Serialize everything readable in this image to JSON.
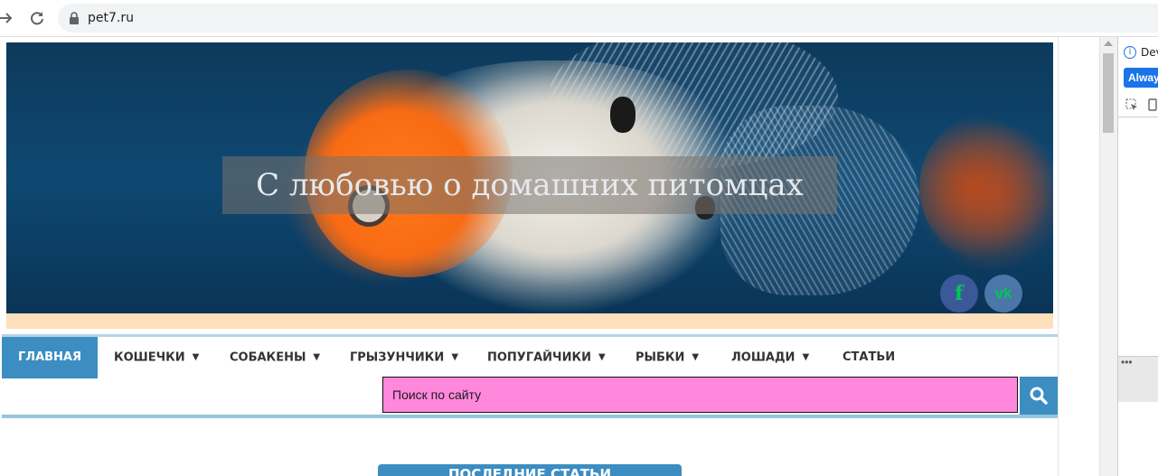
{
  "browser": {
    "url": "pet7.ru"
  },
  "site": {
    "title": "С любовью о домашних питомцах",
    "social": {
      "facebook_label": "f",
      "vk_label": "vk"
    }
  },
  "menu": {
    "items": [
      {
        "label": "ГЛАВНАЯ",
        "active": true,
        "dropdown": false
      },
      {
        "label": "КОШЕЧКИ",
        "dropdown": true
      },
      {
        "label": "СОБАКЕНЫ",
        "dropdown": true
      },
      {
        "label": "ГРЫЗУНЧИКИ",
        "dropdown": true
      },
      {
        "label": "ПОПУГАЙЧИКИ",
        "dropdown": true
      },
      {
        "label": "РЫБКИ",
        "dropdown": true
      },
      {
        "label": "ЛОШАДИ",
        "dropdown": true
      },
      {
        "label": "СТАТЬИ",
        "dropdown": false
      }
    ],
    "arrow": "▼"
  },
  "search": {
    "placeholder": "Поиск по сайту"
  },
  "latest": {
    "label": "ПОСЛЕДНИЕ СТАТЬИ"
  },
  "devtools": {
    "info_text": "Dev",
    "button_label": "Alway"
  },
  "colors": {
    "accent": "#3b8dc2",
    "search_bg": "#ff88dc",
    "peach": "#ffe0bd"
  }
}
